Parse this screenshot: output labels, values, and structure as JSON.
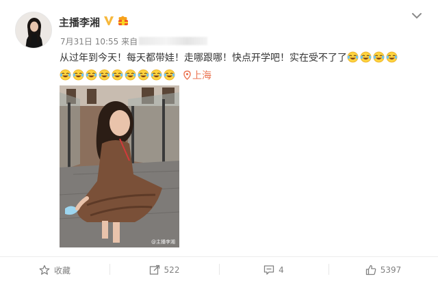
{
  "post": {
    "author": "主播李湘",
    "time": "7月31日 10:55 来自",
    "text": "从过年到今天！每天都带娃！走哪跟哪！快点开学吧！实在受不了了",
    "emoji_name": "laugh-cry-emoji",
    "emoji_count_line1": 4,
    "emoji_count_line2": 9,
    "location": "上海",
    "photo_watermark": "@主播李湘"
  },
  "actions": {
    "favorite_label": "收藏",
    "repost_count": "522",
    "comment_count": "4",
    "like_count": "5397"
  },
  "colors": {
    "link_orange": "#eb7350",
    "verified_gold": "#f6b83d",
    "muted_text": "#808080"
  }
}
